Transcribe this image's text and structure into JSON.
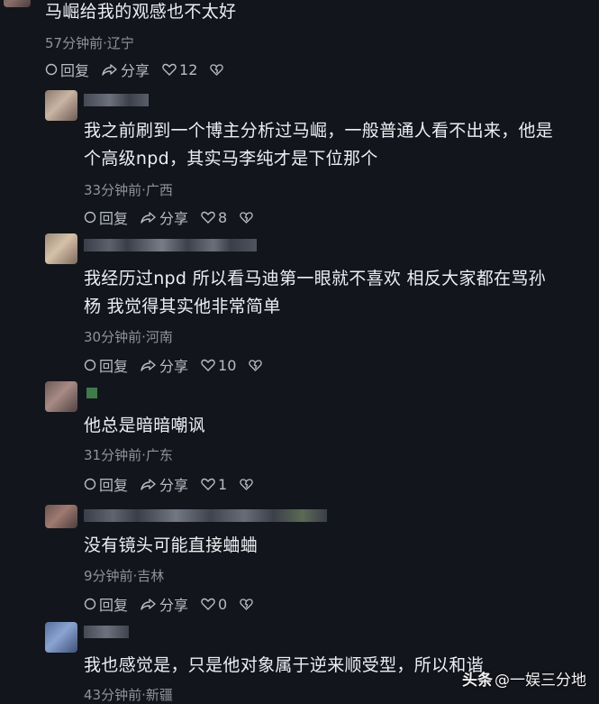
{
  "comments": [
    {
      "text_lines": [
        "马崛给我的观感也不太好"
      ],
      "meta": "57分钟前·辽宁",
      "reply": "回复",
      "share": "分享",
      "likes": "12"
    },
    {
      "text_lines": [
        "我之前刷到一个博主分析过马崛，一般普通人看不出来，他是",
        "个高级npd，其实马李纯才是下位那个"
      ],
      "meta": "33分钟前·广西",
      "reply": "回复",
      "share": "分享",
      "likes": "8"
    },
    {
      "text_lines": [
        "我经历过npd 所以看马迪第一眼就不喜欢 相反大家都在骂孙",
        "杨 我觉得其实他非常简单"
      ],
      "meta": "30分钟前·河南",
      "reply": "回复",
      "share": "分享",
      "likes": "10"
    },
    {
      "text_lines": [
        "他总是暗暗嘲讽"
      ],
      "meta": "31分钟前·广东",
      "reply": "回复",
      "share": "分享",
      "likes": "1"
    },
    {
      "text_lines": [
        "没有镜头可能直接蛐蛐"
      ],
      "meta": "9分钟前·吉林",
      "reply": "回复",
      "share": "分享",
      "likes": "0"
    },
    {
      "text_lines": [
        "我也感觉是，只是他对象属于逆来顺受型，所以和谐"
      ],
      "meta": "43分钟前·新疆",
      "reply": "",
      "share": "",
      "likes": ""
    }
  ],
  "watermark": {
    "brand": "头条",
    "handle": "@一娱三分地"
  }
}
